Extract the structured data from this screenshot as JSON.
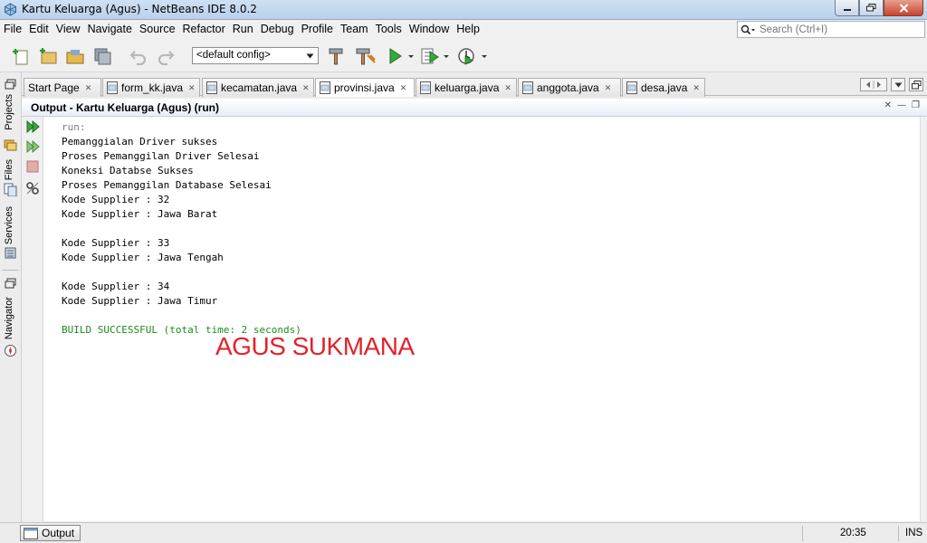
{
  "window": {
    "title": "Kartu Keluarga (Agus) - NetBeans IDE 8.0.2"
  },
  "menu": {
    "items": [
      "File",
      "Edit",
      "View",
      "Navigate",
      "Source",
      "Refactor",
      "Run",
      "Debug",
      "Profile",
      "Team",
      "Tools",
      "Window",
      "Help"
    ]
  },
  "search": {
    "placeholder": "Search (Ctrl+I)"
  },
  "toolbar": {
    "config_value": "<default config>"
  },
  "sidebar": {
    "projects": "Projects",
    "files": "Files",
    "services": "Services",
    "navigator": "Navigator"
  },
  "tabs": [
    {
      "label": "Start Page"
    },
    {
      "label": "form_kk.java"
    },
    {
      "label": "kecamatan.java"
    },
    {
      "label": "provinsi.java"
    },
    {
      "label": "keluarga.java"
    },
    {
      "label": "anggota.java"
    },
    {
      "label": "desa.java"
    }
  ],
  "output": {
    "title": "Output - Kartu Keluarga (Agus) (run)",
    "lines": [
      "run:",
      "Pemanggialan Driver sukses",
      "Proses Pemanggilan Driver Selesai",
      "Koneksi Databse Sukses",
      "Proses Pemanggilan Database Selesai",
      "Kode Supplier : 32",
      "Kode Supplier : Jawa Barat",
      "",
      "Kode Supplier : 33",
      "Kode Supplier : Jawa Tengah",
      "",
      "Kode Supplier : 34",
      "Kode Supplier : Jawa Timur",
      "",
      "BUILD SUCCESSFUL (total time: 2 seconds)"
    ],
    "watermark": "AGUS SUKMANA"
  },
  "status": {
    "output_label": "Output",
    "time": "20:35",
    "mode": "INS"
  },
  "colors": {
    "success": "#1e8a1e",
    "watermark": "#e0232c",
    "muted": "#7c7c7c"
  }
}
